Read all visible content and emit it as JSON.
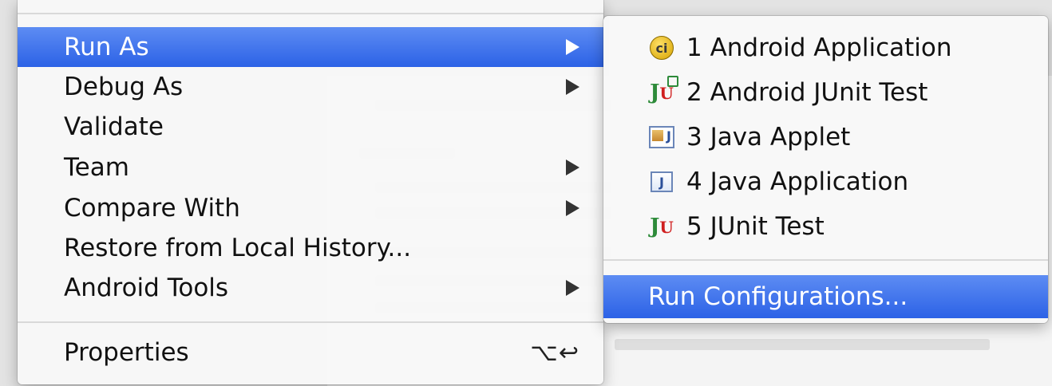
{
  "context_menu": {
    "items": [
      {
        "label": "Run As",
        "has_submenu": true,
        "highlighted": true
      },
      {
        "label": "Debug As",
        "has_submenu": true
      },
      {
        "label": "Validate",
        "has_submenu": false
      },
      {
        "label": "Team",
        "has_submenu": true
      },
      {
        "label": "Compare With",
        "has_submenu": true
      },
      {
        "label": "Restore from Local History...",
        "has_submenu": false
      },
      {
        "label": "Android Tools",
        "has_submenu": true
      }
    ],
    "properties": {
      "label": "Properties",
      "shortcut": "⌥↩"
    }
  },
  "submenu": {
    "items": [
      {
        "label": "1 Android Application",
        "icon": "android-application-icon"
      },
      {
        "label": "2 Android JUnit Test",
        "icon": "android-junit-icon"
      },
      {
        "label": "3 Java Applet",
        "icon": "java-applet-icon"
      },
      {
        "label": "4 Java Application",
        "icon": "java-application-icon"
      },
      {
        "label": "5 JUnit Test",
        "icon": "junit-icon"
      }
    ],
    "run_configurations": {
      "label": "Run Configurations..."
    }
  },
  "colors": {
    "highlight": "#2c62e6",
    "menu_background": "#f8f8f8"
  }
}
